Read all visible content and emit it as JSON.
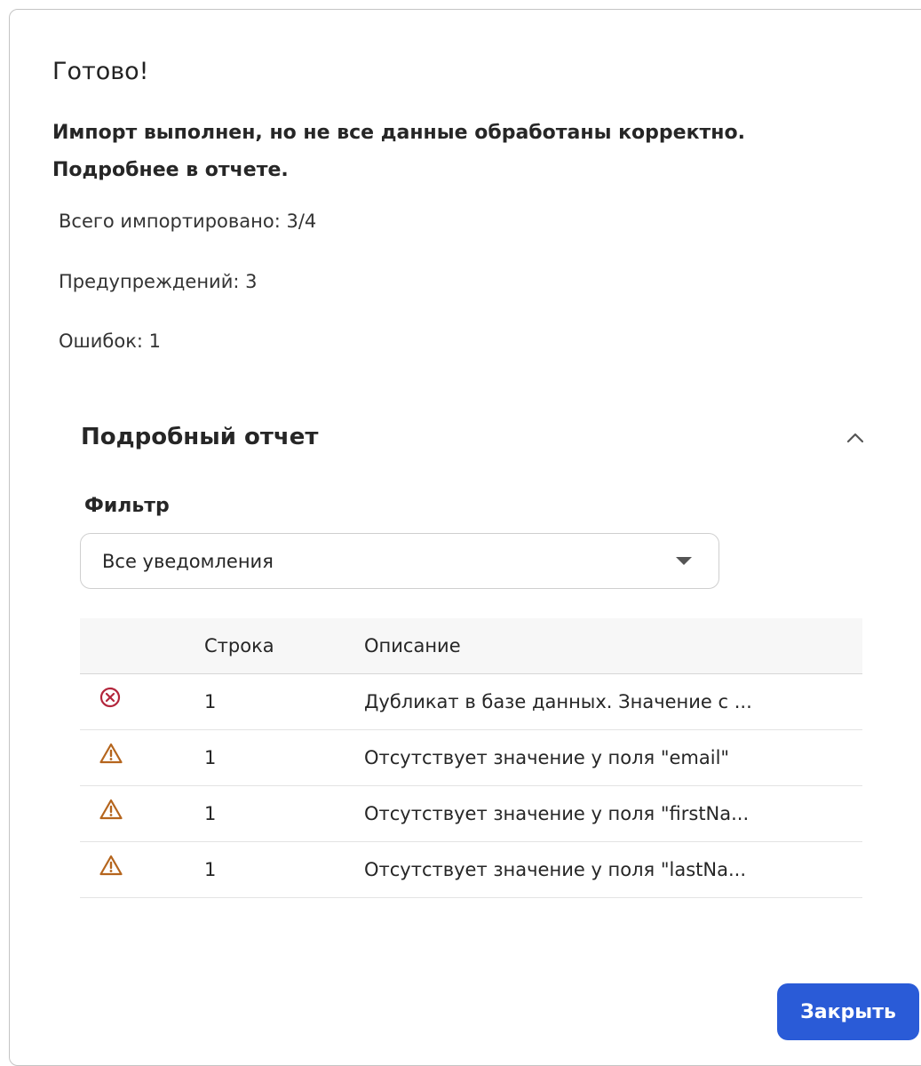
{
  "dialog": {
    "title": "Готово!",
    "message": "Импорт выполнен, но не все данные обработаны корректно. Подробнее в отчете.",
    "stats": {
      "total": "Всего импортировано: 3/4",
      "warnings": "Предупреждений: 3",
      "errors": "Ошибок: 1"
    }
  },
  "report": {
    "title": "Подробный отчет",
    "collapse_icon": "chevron-up-icon",
    "filter": {
      "label": "Фильтр",
      "selected": "Все уведомления"
    },
    "table": {
      "headers": [
        "",
        "Строка",
        "Описание"
      ],
      "rows": [
        {
          "type": "error",
          "icon": "error-circle-icon",
          "row": "1",
          "description": "Дубликат в базе данных. Значение с ..."
        },
        {
          "type": "warning",
          "icon": "warning-triangle-icon",
          "row": "1",
          "description": "Отсутствует значение у поля \"email\""
        },
        {
          "type": "warning",
          "icon": "warning-triangle-icon",
          "row": "1",
          "description": "Отсутствует значение у поля \"firstNa..."
        },
        {
          "type": "warning",
          "icon": "warning-triangle-icon",
          "row": "1",
          "description": "Отсутствует значение у поля \"lastNa..."
        }
      ]
    }
  },
  "footer": {
    "close_label": "Закрыть"
  },
  "colors": {
    "primary": "#2a5bd7",
    "error": "#b3263c",
    "warning": "#b5651d"
  }
}
